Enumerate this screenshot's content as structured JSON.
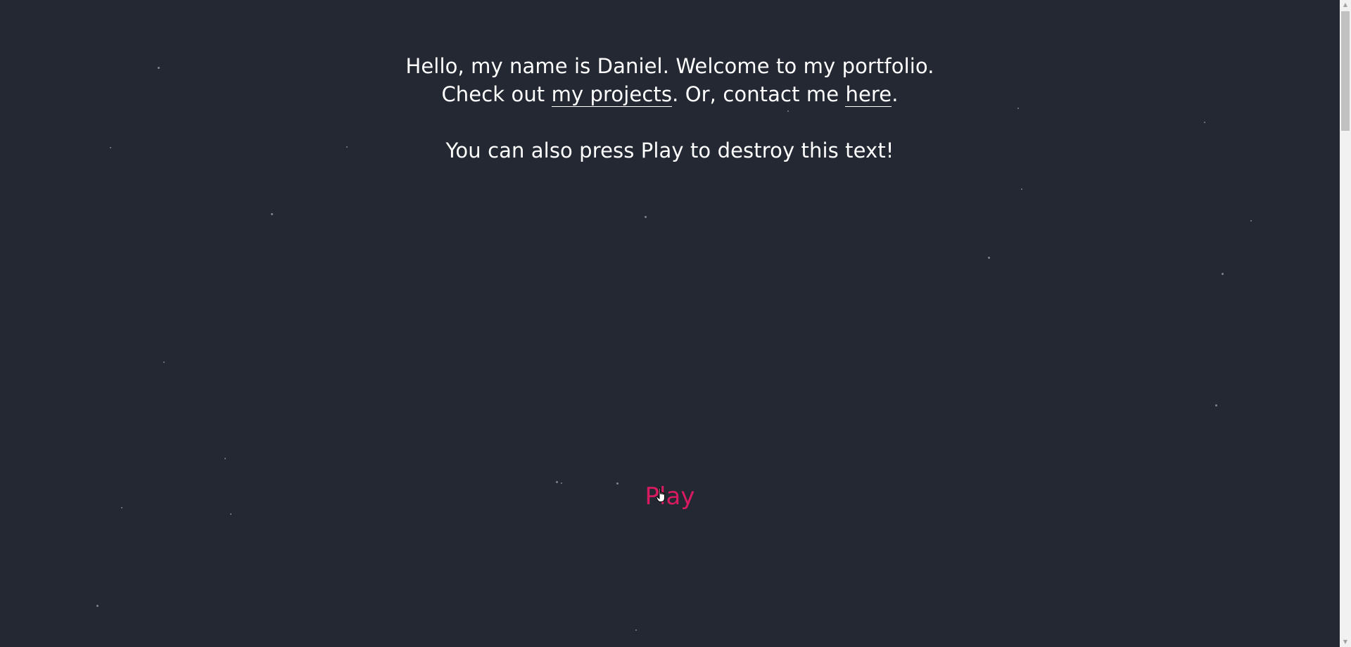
{
  "intro": {
    "line1": "Hello, my name is Daniel. Welcome to my portfolio.",
    "line2_prefix": "Check out ",
    "projects_link": "my projects",
    "line2_middle": ". Or, contact me ",
    "contact_link": "here",
    "line2_suffix": ".",
    "line3": "You can also press Play to destroy this text!"
  },
  "play_label": "Play",
  "colors": {
    "background": "#242833",
    "text": "#ffffff",
    "accent": "#d81b60",
    "star": "#7e8491"
  },
  "icons": {
    "cursor": "hand-pointer-icon",
    "scroll_up": "triangle-up-icon",
    "scroll_down": "triangle-down-icon"
  }
}
